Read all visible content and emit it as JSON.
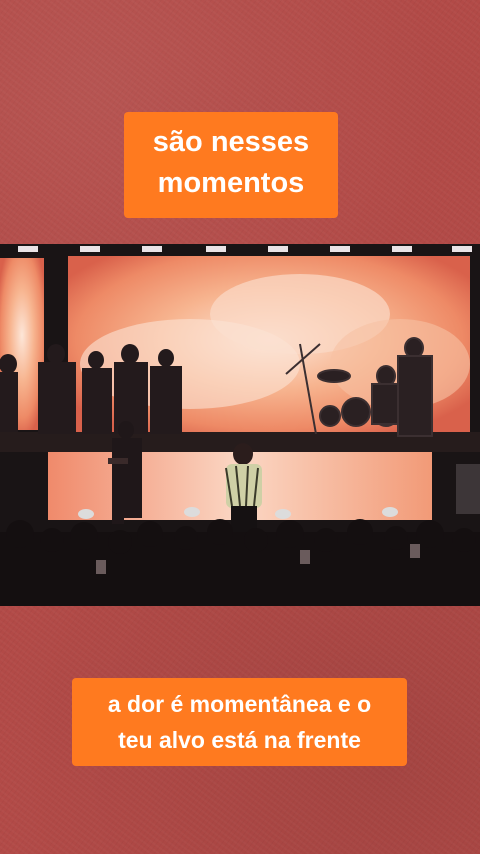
{
  "captions": {
    "top_line1": "são  nesses",
    "top_line2": "momentos",
    "bottom_line1": "a dor é momentânea e o",
    "bottom_line2": "teu alvo está na frente"
  },
  "colors": {
    "background": "#b24a47",
    "caption_bg": "#ff7a1f",
    "caption_text": "#ffffff"
  }
}
